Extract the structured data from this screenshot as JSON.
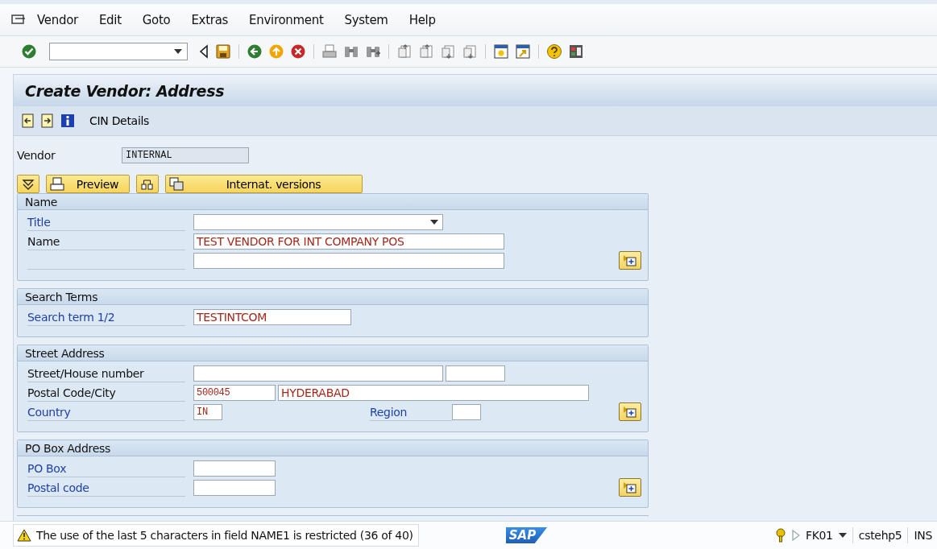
{
  "menu_bar": {
    "items": [
      "Vendor",
      "Edit",
      "Goto",
      "Extras",
      "Environment",
      "System",
      "Help"
    ]
  },
  "title": "Create Vendor: Address",
  "app_toolbar": {
    "buttons": [
      "CIN Details"
    ]
  },
  "vendor": {
    "label": "Vendor",
    "value": "INTERNAL"
  },
  "action_buttons": [
    {
      "kind": "icon"
    },
    {
      "kind": "text",
      "label": "Preview"
    },
    {
      "kind": "icon"
    },
    {
      "kind": "text",
      "label": "Internat. versions"
    }
  ],
  "sections": [
    {
      "title": "Name",
      "rows": [
        {
          "label": "Title",
          "kind": "link",
          "detail_button": false,
          "fields": [
            {
              "kind": "dropdown"
            }
          ]
        },
        {
          "label": "Name",
          "kind": "plain",
          "detail_button": false,
          "fields": [
            {
              "kind": "name",
              "value": "TEST VENDOR FOR INT COMPANY POS"
            }
          ]
        },
        {
          "detail_button": true,
          "fields": [
            {
              "kind": "name"
            }
          ]
        }
      ]
    },
    {
      "title": "Search Terms",
      "rows": [
        {
          "label": "Search term 1/2",
          "kind": "link",
          "detail_button": false,
          "fields": [
            {
              "kind": "search",
              "value": "TESTINTCOM"
            }
          ]
        }
      ]
    },
    {
      "title": "Street Address",
      "rows": [
        {
          "label": "Street/House number",
          "kind": "plain",
          "detail_button": false,
          "fields": [
            {
              "kind": "street"
            },
            {
              "kind": "house"
            }
          ]
        },
        {
          "label": "Postal Code/City",
          "kind": "plain",
          "detail_button": false,
          "fields": [
            {
              "kind": "postal",
              "value": "500045"
            },
            {
              "kind": "city",
              "value": "HYDERABAD"
            }
          ]
        },
        {
          "label": "Country",
          "kind": "link",
          "detail_button": true,
          "fields": [
            {
              "kind": "country",
              "value": "IN"
            },
            {
              "kind": "inline_label",
              "text": "Region"
            },
            {
              "kind": "region"
            }
          ]
        }
      ]
    },
    {
      "title": "PO Box Address",
      "rows": [
        {
          "label": "PO Box",
          "kind": "link",
          "detail_button": false,
          "fields": [
            {
              "kind": "po"
            }
          ]
        },
        {
          "label": "Postal code",
          "kind": "link",
          "detail_button": true,
          "fields": [
            {
              "kind": "po"
            }
          ]
        }
      ]
    }
  ],
  "status_bar": {
    "message": "The use of the last 5 characters in field NAME1 is restricted (36 of 40)",
    "logo": "SAP",
    "transaction": "FK01",
    "server": "cstehp5",
    "mode": "INS"
  }
}
